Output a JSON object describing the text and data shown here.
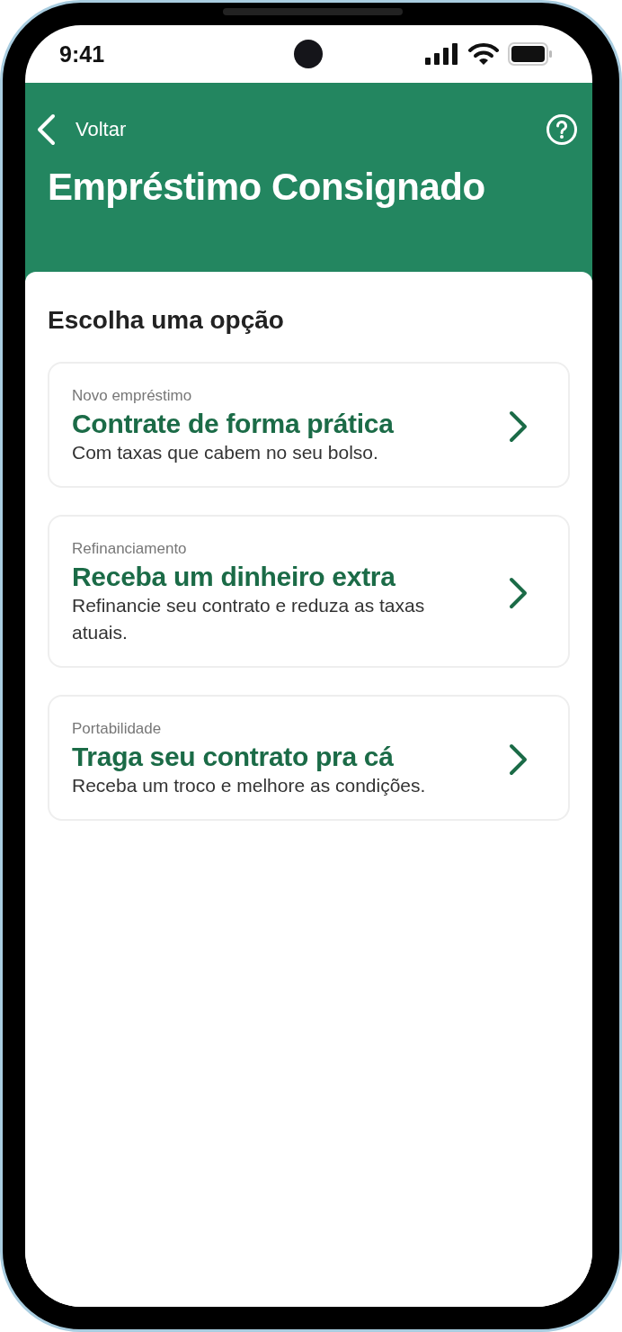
{
  "status_bar": {
    "time": "9:41"
  },
  "header": {
    "back_label": "Voltar",
    "title": "Empréstimo Consignado"
  },
  "section_title": "Escolha uma opção",
  "options": [
    {
      "label": "Novo empréstimo",
      "title": "Contrate de forma prática",
      "description": "Com taxas que cabem no seu bolso."
    },
    {
      "label": "Refinanciamento",
      "title": "Receba um dinheiro extra",
      "description": "Refinancie seu contrato e reduza as taxas atuais."
    },
    {
      "label": "Portabilidade",
      "title": "Traga seu contrato pra cá",
      "description": "Receba um troco e melhore as condições."
    }
  ]
}
